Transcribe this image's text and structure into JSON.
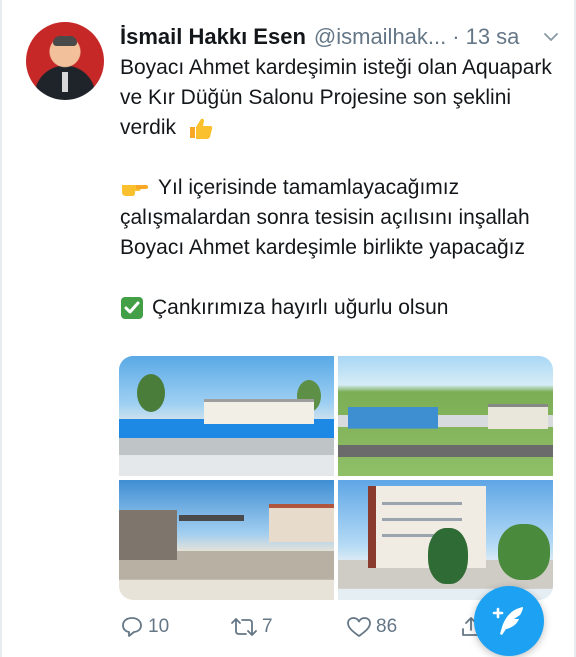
{
  "author": {
    "name": "İsmail Hakkı Esen",
    "handle": "@ismailhak...",
    "separator": "·",
    "time": "13 sa"
  },
  "tweet": {
    "line1": "Boyacı Ahmet kardeşimin isteği olan Aquapark ve Kır Düğün Salonu Projesine son şeklini verdik",
    "line2": "Yıl içerisinde tamamlayacağımız çalışmalardan sonra tesisin açılısını inşallah Boyacı Ahmet kardeşimle birlikte yapacağız",
    "line3": "Çankırımıza hayırlı uğurlu olsun"
  },
  "actions": {
    "reply_count": "10",
    "retweet_count": "7",
    "like_count": "86"
  },
  "icons": {
    "thumbs_up": "thumbs-up-emoji",
    "pointing_right": "backhand-index-pointing-right-emoji",
    "check_mark": "check-mark-button-emoji",
    "compose": "compose-feather-icon"
  },
  "colors": {
    "accent": "#1da1f2",
    "muted_text": "#657786",
    "check_green": "#43a047",
    "thumbs_yellow": "#fbc02d"
  }
}
